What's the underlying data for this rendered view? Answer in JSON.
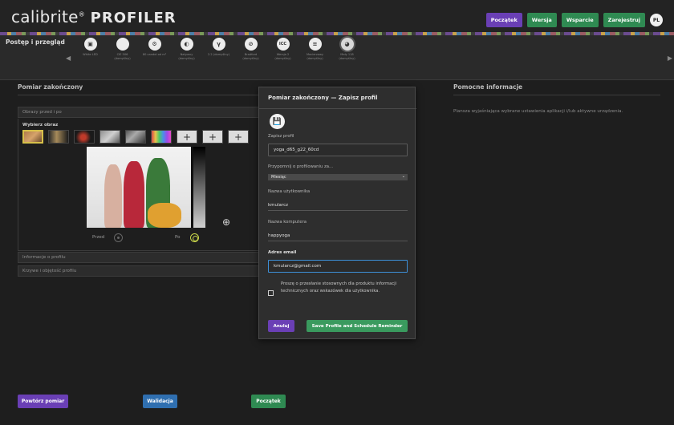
{
  "header": {
    "logo_main": "calibrite",
    "logo_reg": "®",
    "logo_pro": "PROFILER",
    "buttons": [
      "Początek",
      "Wersja",
      "Wsparcie",
      "Zarejestruj"
    ],
    "avatar": "PL"
  },
  "progress": {
    "title": "Postęp i przegląd",
    "steps": [
      {
        "icon": "monitor-icon",
        "glyph": "▣",
        "label": "White LED"
      },
      {
        "icon": "circle-icon",
        "glyph": "",
        "label": "CIE 506 (domyślny)"
      },
      {
        "icon": "settings-icon",
        "glyph": "⚙",
        "label": "80 candel od m²"
      },
      {
        "icon": "contrast-icon",
        "glyph": "◐",
        "label": "Natywny (domyślny)"
      },
      {
        "icon": "gamma-icon",
        "glyph": "γ",
        "label": "2.2 (domyślny)"
      },
      {
        "icon": "flare-off-icon",
        "glyph": "⊘",
        "label": "Bradford (domyślny)"
      },
      {
        "icon": "icc-icon",
        "glyph": "ICC",
        "label": "Wersja 2 (domyślny)"
      },
      {
        "icon": "list-icon",
        "glyph": "≡",
        "label": "Macierzowy (domyślny)"
      },
      {
        "icon": "palette-icon",
        "glyph": "◕",
        "label": "Mały 118 (domyślny)"
      }
    ],
    "arrow_left": "◀",
    "arrow_right": "▶"
  },
  "left": {
    "title": "Pomiar zakończony",
    "accordion_before_after": "Obrazy przed i po",
    "select_image": "Wybierz obraz",
    "plus": "+",
    "before": "Przed",
    "after": "Po",
    "zoom_glyph": "⊕",
    "accordion_profile_info": "Informacje o profilu",
    "accordion_curves": "Krzywe i objętość profilu"
  },
  "right": {
    "title": "Pomocne informacje",
    "text": "Plansza wyjaśniająca wybrane ustawienia aplikacji i/lub aktywne urządzenia."
  },
  "bottom": {
    "repeat": "Powtórz pomiar",
    "validate": "Walidacja",
    "start": "Początek"
  },
  "modal": {
    "title": "Pomiar zakończony — Zapisz profil",
    "save_glyph": "💾",
    "save_profile_label": "Zapisz profil",
    "profile_name": "yoga_d65_g22_60cd",
    "remind_label": "Przypomnij o profilowaniu za...",
    "remind_value": "Miesiąc",
    "chevron": "⌄",
    "username_label": "Nazwa użytkownika",
    "username": "kmularcz",
    "computer_label": "Nazwa komputera",
    "computer": "happyoga",
    "email_label": "Adres email",
    "email": "kmularcz@gmail.com",
    "consent": "Proszę o przesłanie stosownych dla produktu informacji technicznych oraz wskazówek dla użytkownika.",
    "cancel": "Anuluj",
    "save": "Save Profile and Schedule Reminder"
  },
  "colors": {
    "purple": "#6a3fb5",
    "green": "#2f8a52",
    "blue": "#2f6fb0",
    "focus": "#3d8fd8"
  }
}
